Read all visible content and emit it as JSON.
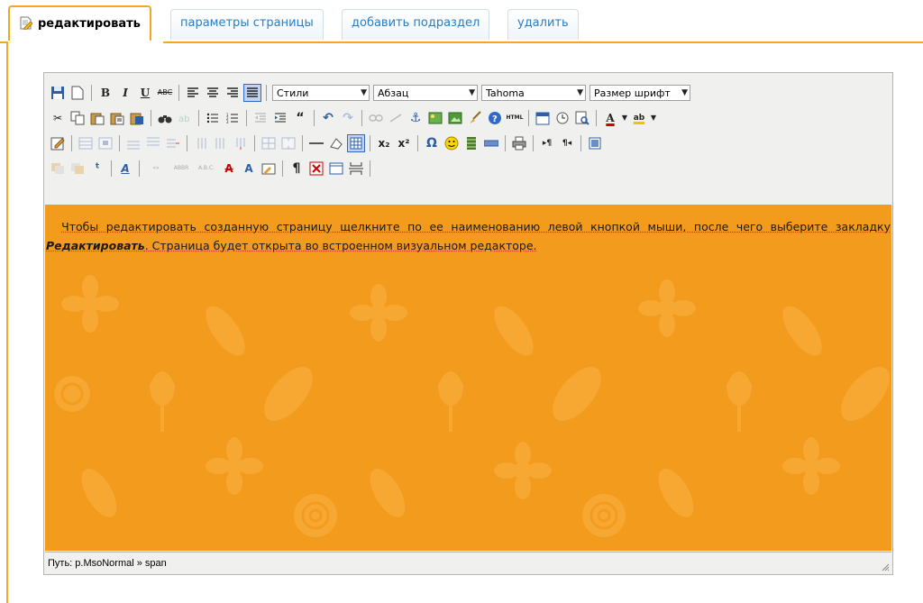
{
  "tabs": [
    {
      "label": "редактировать",
      "active": true
    },
    {
      "label": "параметры страницы",
      "active": false
    },
    {
      "label": "добавить подраздел",
      "active": false
    },
    {
      "label": "удалить",
      "active": false
    }
  ],
  "toolbar": {
    "styles_select": "Стили",
    "format_select": "Абзац",
    "font_select": "Tahoma",
    "size_select": "Размер шрифт",
    "bold": "B",
    "italic": "I",
    "underline": "U",
    "strike": "ABC",
    "html": "HTML",
    "subscript": "x₂",
    "superscript": "x²",
    "omega": "Ω",
    "pilcrow": "¶",
    "font_color": "A",
    "highlight": "ab"
  },
  "content": {
    "part1": "Чтобы редактировать созданную страницу щелкните по ее наименованию левой кнопкой мыши, после чего выберите закладку ",
    "emphasis": "Редактировать",
    "part2": ". Страница будет открыта во встроенном визуальном редакторе."
  },
  "status": {
    "path": "Путь: p.MsoNormal » span"
  },
  "colors": {
    "accent": "#f5a623",
    "content_bg": "#f39b1c",
    "tab_text": "#2a7dbf"
  }
}
